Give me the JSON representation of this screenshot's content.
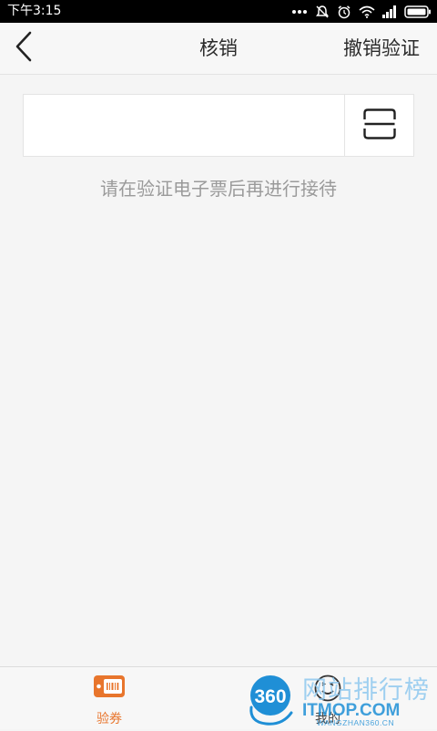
{
  "status_bar": {
    "time": "下午3:15"
  },
  "header": {
    "back_icon": "chevron-left-icon",
    "title": "核销",
    "action_label": "撤销验证"
  },
  "verify": {
    "input_value": "",
    "input_placeholder": "",
    "scan_icon": "scan-icon",
    "hint": "请在验证电子票后再进行接待"
  },
  "tabs": [
    {
      "label": "验券",
      "icon": "ticket-icon",
      "active": true
    },
    {
      "label": "我的",
      "icon": "smiley-icon",
      "active": false
    }
  ],
  "watermark": {
    "badge": "360",
    "text": "网站排行榜",
    "domain": "ITMOP.COM",
    "subdomain": "WANGZHAN360.CN"
  },
  "colors": {
    "accent": "#e8752c",
    "text_primary": "#2b2b2b",
    "text_hint": "#9a9a9a",
    "background": "#f5f5f5",
    "watermark_blue": "#1f8fd6"
  }
}
